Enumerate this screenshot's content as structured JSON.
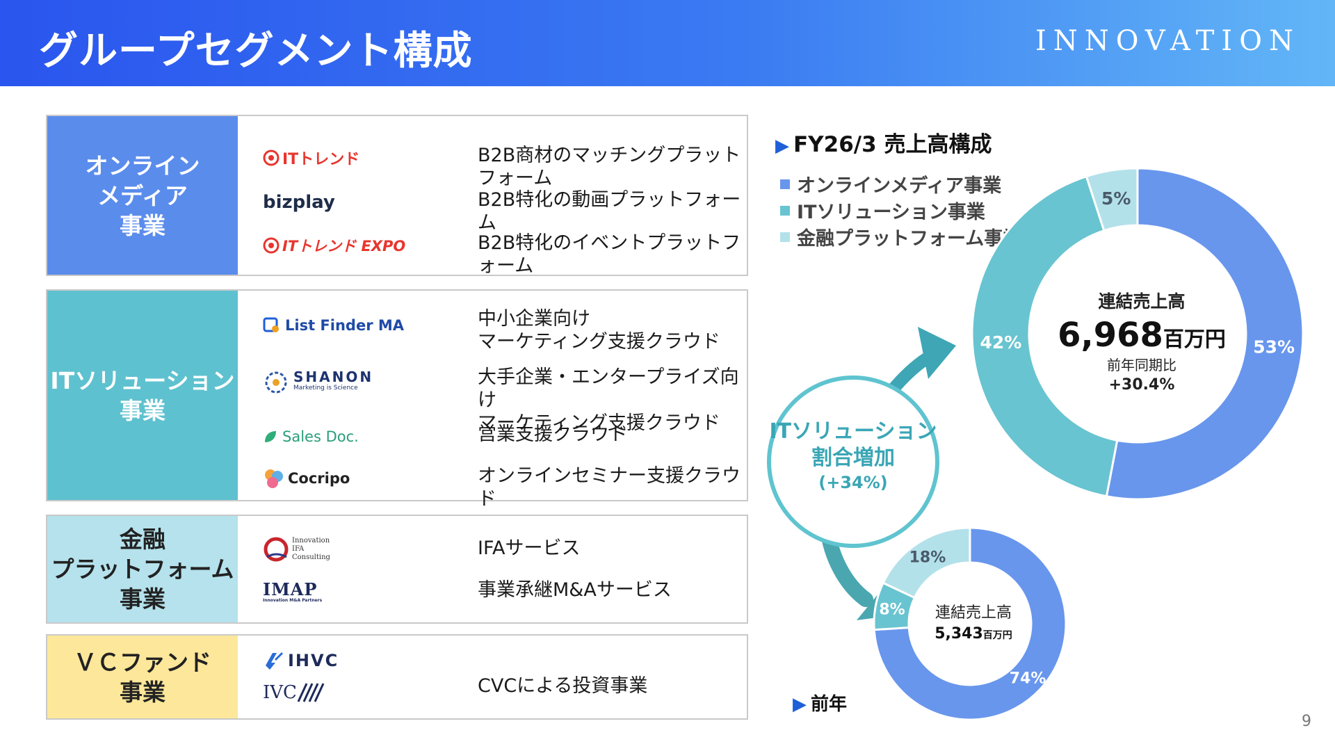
{
  "header": {
    "title": "グループセグメント構成",
    "brand": "INNOVATION"
  },
  "segments": [
    {
      "name": "オンライン\nメディア\n事業",
      "color": "#5a8cec",
      "text_color": "#ffffff",
      "rows": [
        {
          "logo": "ITトレンド",
          "desc": "B2B商材のマッチングプラットフォーム"
        },
        {
          "logo": "bizplay",
          "desc": "B2B特化の動画プラットフォーム"
        },
        {
          "logo": "ITトレンド EXPO",
          "desc": "B2B特化のイベントプラットフォーム"
        }
      ]
    },
    {
      "name": "ITソリューション\n事業",
      "color": "#5ec1cf",
      "text_color": "#ffffff",
      "rows": [
        {
          "logo": "List Finder MA",
          "desc": "中小企業向け\nマーケティング支援クラウド"
        },
        {
          "logo": "SHANON",
          "logo_sub": "Marketing is Science",
          "desc": "大手企業・エンタープライズ向け\nマーケティング支援クラウド"
        },
        {
          "logo": "Sales Doc.",
          "desc": "営業支援クラウド"
        },
        {
          "logo": "Cocripo",
          "desc": "オンラインセミナー支援クラウド"
        }
      ]
    },
    {
      "name": "金融\nプラットフォーム\n事業",
      "color": "#b5e2ec",
      "text_color": "#222222",
      "rows": [
        {
          "logo": "Innovation IFA Consulting",
          "desc": "IFAサービス"
        },
        {
          "logo": "IMAP",
          "logo_sub": "Innovation M&A Partners",
          "desc": "事業承継M&Aサービス"
        }
      ]
    },
    {
      "name": "ＶＣファンド\n事業",
      "color": "#fde79a",
      "text_color": "#222222",
      "rows": [
        {
          "logo": "IHVC",
          "desc": ""
        },
        {
          "logo": "IVC",
          "desc": "CVCによる投資事業"
        }
      ]
    }
  ],
  "chart_data": [
    {
      "type": "pie",
      "title": "FY26/3 売上高構成",
      "categories": [
        "オンラインメディア事業",
        "ITソリューション事業",
        "金融プラットフォーム事業"
      ],
      "values": [
        53,
        42,
        5
      ],
      "labels": [
        "53%",
        "42%",
        "5%"
      ],
      "colors": [
        "#6896ec",
        "#68c4d0",
        "#b3e1ea"
      ],
      "center": {
        "label": "連結売上高",
        "value": "6,968",
        "unit": "百万円",
        "yoy_label": "前年同期比",
        "yoy": "+30.4%"
      },
      "legend": "top-left"
    },
    {
      "type": "pie",
      "title": "前年",
      "categories": [
        "オンラインメディア事業",
        "ITソリューション事業",
        "金融プラットフォーム事業"
      ],
      "values": [
        74,
        8,
        18
      ],
      "labels": [
        "74%",
        "8%",
        "18%"
      ],
      "colors": [
        "#6896ec",
        "#68c4d0",
        "#b3e1ea"
      ],
      "center": {
        "label": "連結売上高",
        "value": "5,343",
        "unit": "百万円"
      }
    }
  ],
  "callout": {
    "line1": "ITソリューション",
    "line2": "割合増加",
    "line3": "(+34%)"
  },
  "page_number": "9"
}
